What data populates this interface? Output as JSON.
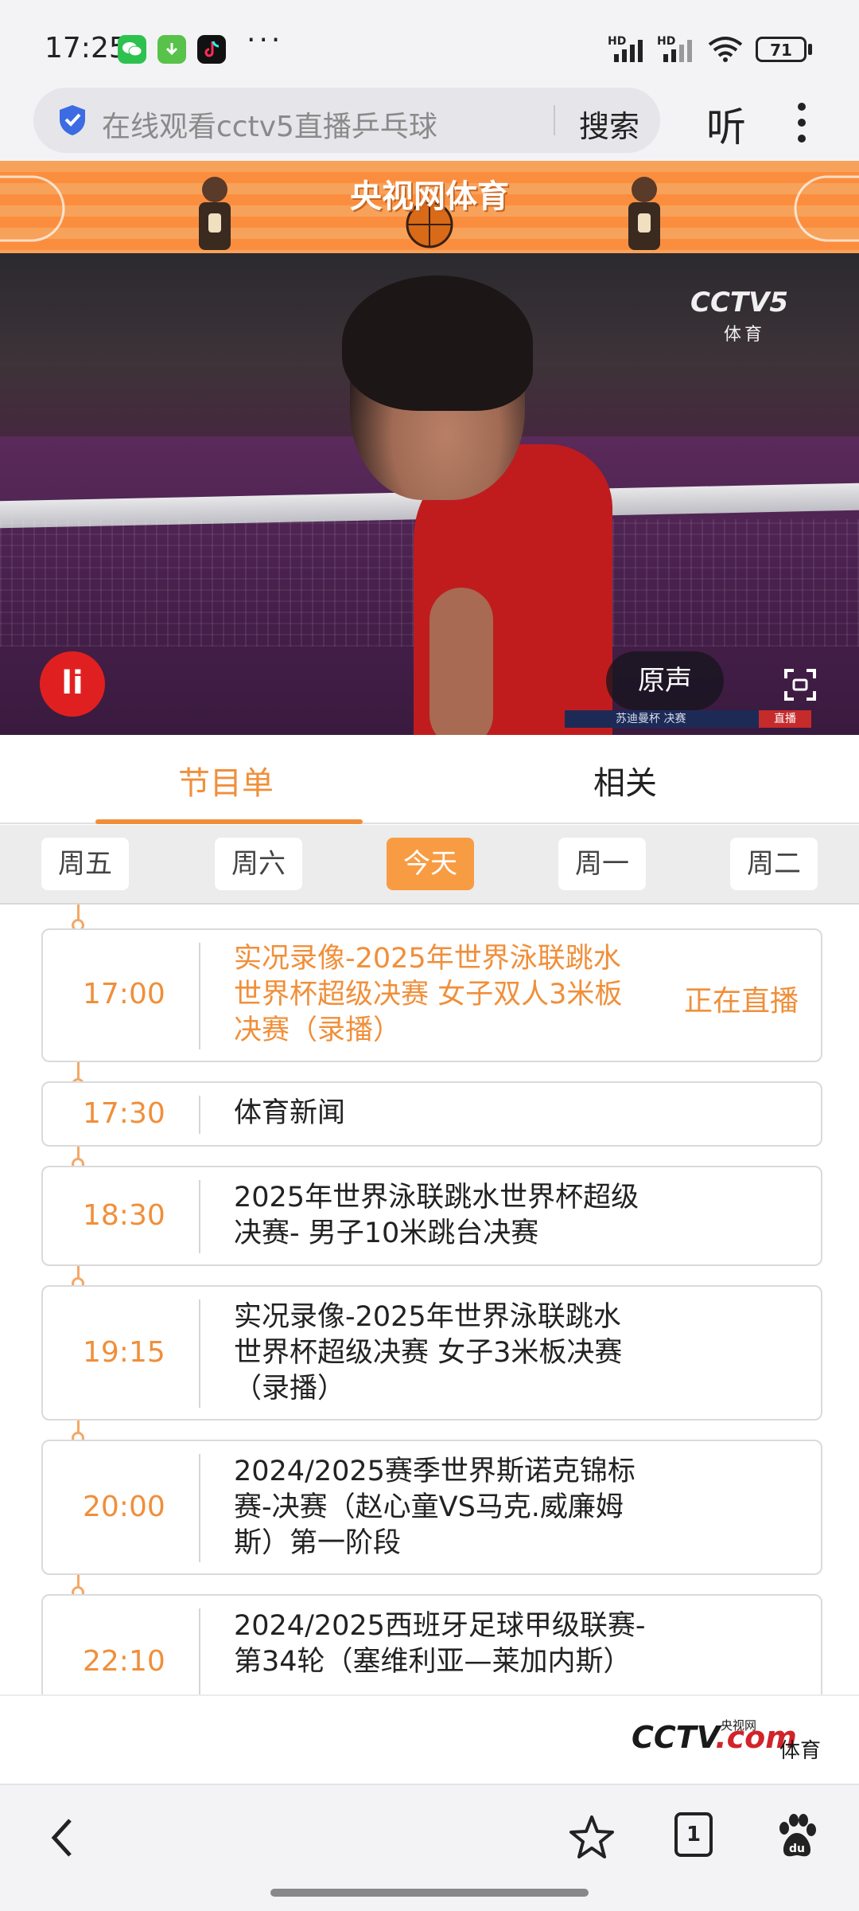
{
  "status_bar": {
    "time": "17:25",
    "network1": "HD",
    "network2": "HD",
    "battery": "71",
    "more": "···",
    "apps": [
      "wechat-icon",
      "download-icon",
      "tiktok-icon"
    ]
  },
  "browser": {
    "search_text": "在线观看cctv5直播乒乓球",
    "search_button": "搜索",
    "listen_button": "听"
  },
  "banner": {
    "title": "央视网体育"
  },
  "video": {
    "channel_logo": "CCTV5",
    "channel_sub": "体育",
    "audio_button": "原声",
    "live_logo": "li",
    "ticker": "苏迪曼杯  决赛",
    "ticker_live": "直播"
  },
  "tabs": {
    "program": "节目单",
    "related": "相关"
  },
  "days": [
    "周五",
    "周六",
    "今天",
    "周一",
    "周二"
  ],
  "programs": [
    {
      "time": "17:00",
      "title": "实况录像-2025年世界泳联跳水世界杯超级决赛 女子双人3米板决赛（录播）",
      "status": "正在直播"
    },
    {
      "time": "17:30",
      "title": "体育新闻",
      "status": ""
    },
    {
      "time": "18:30",
      "title": "2025年世界泳联跳水世界杯超级决赛- 男子10米跳台决赛",
      "status": ""
    },
    {
      "time": "19:15",
      "title": "实况录像-2025年世界泳联跳水世界杯超级决赛 女子3米板决赛（录播）",
      "status": ""
    },
    {
      "time": "20:00",
      "title": "2024/2025赛季世界斯诺克锦标赛-决赛（赵心童VS马克.威廉姆斯）第一阶段",
      "status": ""
    },
    {
      "time": "22:10",
      "title": "2024/2025西班牙足球甲级联赛-第34轮（塞维利亚—莱加内斯）",
      "status": ""
    }
  ],
  "footer": {
    "logo_cctv": "CCTV",
    "logo_com": ".com",
    "logo_cn": "央视网",
    "logo_sport": "体育"
  },
  "bottom_nav": {
    "tab_count": "1"
  },
  "colors": {
    "accent": "#f08f3a",
    "banner": "#fb8e3e",
    "live_red": "#e02020"
  }
}
